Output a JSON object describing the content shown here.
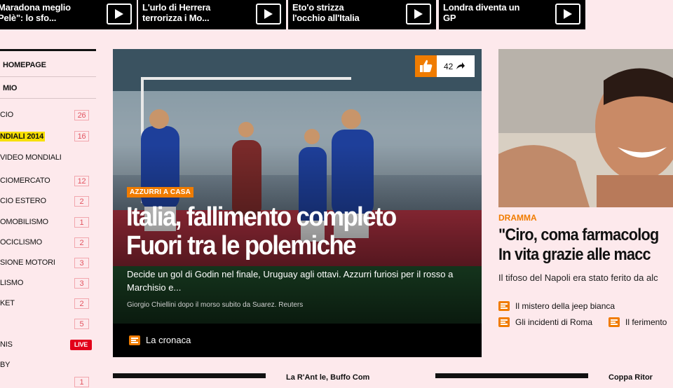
{
  "top_strip": {
    "cards": [
      {
        "title": "Maradona meglio Pelè\": lo sfo..."
      },
      {
        "title": "L'urlo di Herrera terrorizza i Mo..."
      },
      {
        "title": "Eto'o strizza l'occhio all'Italia"
      },
      {
        "title": "Londra diventa un GP"
      }
    ],
    "play_icon": "play-icon"
  },
  "sidebar": {
    "items": [
      {
        "label": "HOMEPAGE",
        "bold": true
      },
      {
        "label": "MIO",
        "bold": true
      },
      {
        "label": "CIO",
        "count": "26"
      },
      {
        "label": "NDIALI 2014",
        "count": "16",
        "highlight": true
      },
      {
        "label": "VIDEO MONDIALI"
      },
      {
        "label": "CIOMERCATO",
        "count": "12"
      },
      {
        "label": "CIO ESTERO",
        "count": "2"
      },
      {
        "label": "OMOBILISMO",
        "count": "1"
      },
      {
        "label": "OCICLISMO",
        "count": "2"
      },
      {
        "label": "SIONE MOTORI",
        "count": "3"
      },
      {
        "label": "LISMO",
        "count": "3"
      },
      {
        "label": "KET",
        "count": "2"
      },
      {
        "label": "",
        "count": "5"
      },
      {
        "label": "NIS",
        "live": "LIVE"
      },
      {
        "label": "BY",
        "count": "1"
      }
    ]
  },
  "hero": {
    "like_count": "42",
    "like_icon": "thumbs-up-icon",
    "share_icon": "share-arrow-icon",
    "kicker": "AZZURRI A CASA",
    "title_line1": "Italia, fallimento completo",
    "title_line2": "Fuori tra le polemiche",
    "description": "Decide un gol di Godin nel finale, Uruguay agli ottavi. Azzurri furiosi per il rosso a Marchisio e...",
    "caption": "Giorgio Chiellini dopo il morso subito da Suarez. Reuters",
    "footer_link": "La cronaca"
  },
  "right_story": {
    "kicker": "DRAMMA",
    "title_line1": "\"Ciro, coma farmacolog",
    "title_line2": "In vita grazie alle macc",
    "description": "Il tifoso del Napoli era stato ferito da alc",
    "links": [
      {
        "label": "Il mistero della jeep bianca"
      },
      {
        "label": "Gli incidenti di Roma"
      },
      {
        "label": "Il ferimento"
      }
    ]
  },
  "bottom_row": {
    "snippet1": "La R'Ant    le, Buffo Com",
    "snippet2": "Coppa Ritor"
  },
  "colors": {
    "background": "#fde9ec",
    "accent": "#f07c00",
    "live": "#e2001a"
  }
}
